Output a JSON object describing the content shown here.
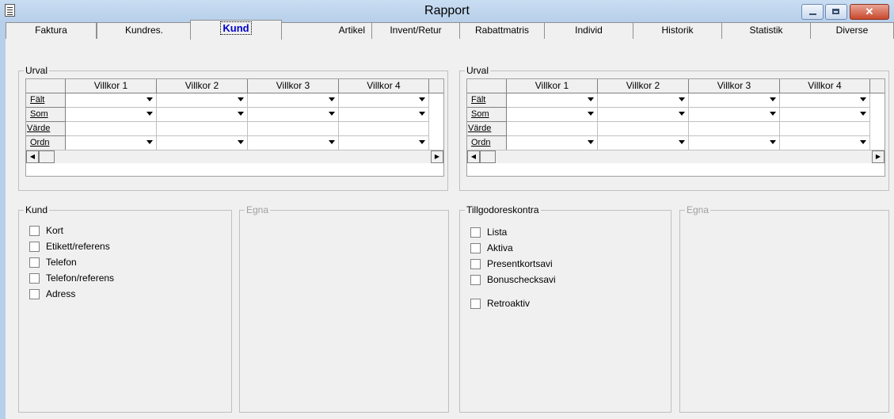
{
  "window": {
    "title": "Rapport",
    "close_glyph": "✕"
  },
  "tabs": [
    {
      "label": "Faktura",
      "active": false
    },
    {
      "label": "Kundres.",
      "active": false
    },
    {
      "label": "Kund",
      "active": true
    },
    {
      "label": "Artikel",
      "active": false
    },
    {
      "label": "Invent/Retur",
      "active": false
    },
    {
      "label": "Rabattmatris",
      "active": false
    },
    {
      "label": "Individ",
      "active": false
    },
    {
      "label": "Historik",
      "active": false
    },
    {
      "label": "Statistik",
      "active": false
    },
    {
      "label": "Diverse",
      "active": false
    }
  ],
  "urval_left": {
    "legend": "Urval",
    "columns": [
      "Villkor 1",
      "Villkor 2",
      "Villkor 3",
      "Villkor 4"
    ],
    "rows": [
      "Fält",
      "Som",
      "Värde",
      "Ordn"
    ]
  },
  "urval_right": {
    "legend": "Urval",
    "columns": [
      "Villkor 1",
      "Villkor 2",
      "Villkor 3",
      "Villkor 4"
    ],
    "rows": [
      "Fält",
      "Som",
      "Värde",
      "Ordn"
    ]
  },
  "kund": {
    "legend": "Kund",
    "items": [
      "Kort",
      "Etikett/referens",
      "Telefon",
      "Telefon/referens",
      "Adress"
    ]
  },
  "egna_left": {
    "legend": "Egna"
  },
  "tillgodo": {
    "legend": "Tillgodoreskontra",
    "items": [
      "Lista",
      "Aktiva",
      "Presentkortsavi",
      "Bonuschecksavi"
    ],
    "extra_item": "Retroaktiv"
  },
  "egna_right": {
    "legend": "Egna"
  }
}
